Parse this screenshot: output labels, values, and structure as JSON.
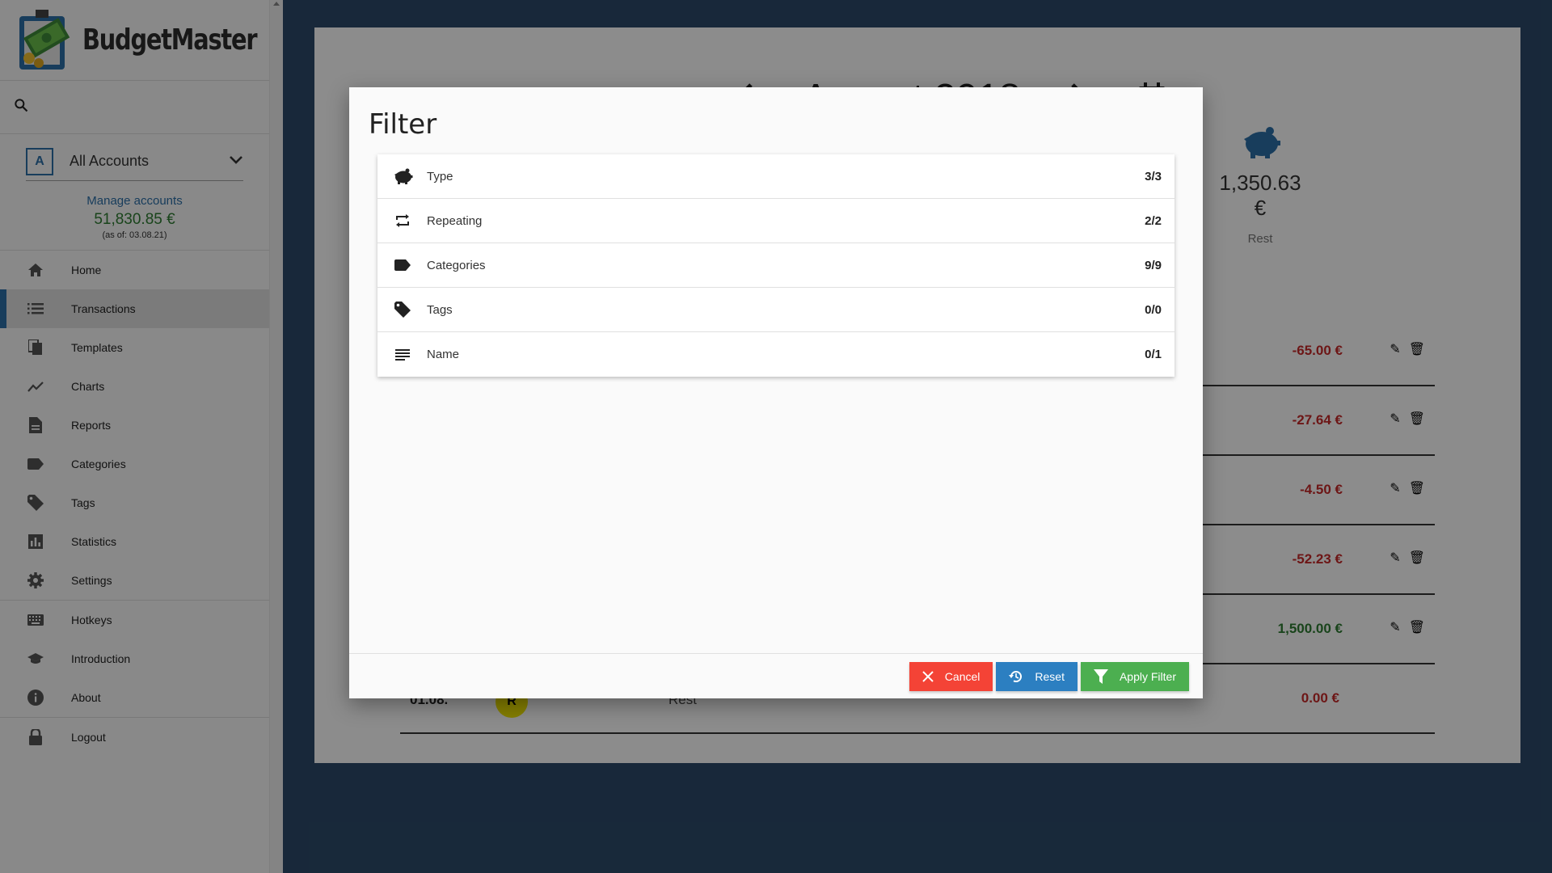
{
  "app": {
    "name": "BudgetMaster"
  },
  "account": {
    "badge": "A",
    "selected": "All Accounts",
    "manage_label": "Manage accounts",
    "balance": "51,830.85 €",
    "as_of": "(as of: 03.08.21)"
  },
  "nav": {
    "items": [
      {
        "label": "Home",
        "icon": "home-icon"
      },
      {
        "label": "Transactions",
        "icon": "list-icon",
        "active": true
      },
      {
        "label": "Templates",
        "icon": "file-copy-icon"
      },
      {
        "label": "Charts",
        "icon": "show-chart-icon"
      },
      {
        "label": "Reports",
        "icon": "description-icon"
      },
      {
        "label": "Categories",
        "icon": "label-icon"
      },
      {
        "label": "Tags",
        "icon": "local-offer-icon"
      },
      {
        "label": "Statistics",
        "icon": "bar-chart-icon"
      },
      {
        "label": "Settings",
        "icon": "gear-icon"
      },
      {
        "label": "Hotkeys",
        "icon": "keyboard-icon"
      },
      {
        "label": "Introduction",
        "icon": "school-icon"
      },
      {
        "label": "About",
        "icon": "info-icon"
      },
      {
        "label": "Logout",
        "icon": "lock-icon"
      }
    ]
  },
  "main": {
    "month": "August 2018",
    "rest_amount": "1,350.63 €",
    "rest_label": "Rest",
    "transactions": [
      {
        "amount": "-65.00 €",
        "color": "#c62828"
      },
      {
        "amount": "-27.64 €",
        "color": "#c62828"
      },
      {
        "amount": "-4.50 €",
        "color": "#c62828"
      },
      {
        "amount": "-52.23 €",
        "color": "#c62828"
      },
      {
        "amount": "1,500.00 €",
        "color": "#2e7d32"
      },
      {
        "date": "01.08.",
        "badge": "R",
        "name": "Rest",
        "amount": "0.00 €",
        "color": "#c62828"
      }
    ]
  },
  "modal": {
    "title": "Filter",
    "filters": [
      {
        "label": "Type",
        "count": "3/3",
        "icon": "piggy-bank-icon"
      },
      {
        "label": "Repeating",
        "count": "2/2",
        "icon": "repeat-icon"
      },
      {
        "label": "Categories",
        "count": "9/9",
        "icon": "label-icon"
      },
      {
        "label": "Tags",
        "count": "0/0",
        "icon": "local-offer-icon"
      },
      {
        "label": "Name",
        "count": "0/1",
        "icon": "notes-icon"
      }
    ],
    "buttons": {
      "cancel": "Cancel",
      "reset": "Reset",
      "apply": "Apply Filter"
    }
  },
  "colors": {
    "accent": "#2c6fa8",
    "background": "#2c4a6a",
    "cancel": "#f44336",
    "reset": "#2c7fc1",
    "apply": "#4caf50"
  }
}
